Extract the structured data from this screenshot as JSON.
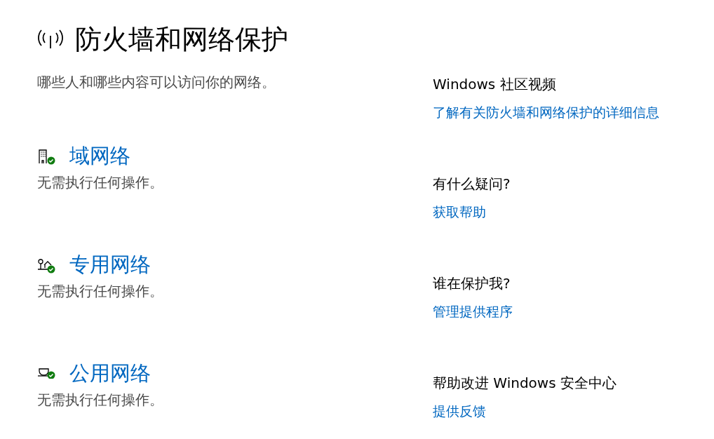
{
  "page": {
    "title": "防火墙和网络保护",
    "subtitle": "哪些人和哪些内容可以访问你的网络。"
  },
  "networks": [
    {
      "kind": "domain",
      "name": "域网络",
      "status": "无需执行任何操作。"
    },
    {
      "kind": "private",
      "name": "专用网络",
      "status": "无需执行任何操作。"
    },
    {
      "kind": "public",
      "name": "公用网络",
      "status": "无需执行任何操作。"
    }
  ],
  "side_sections": [
    {
      "heading": "Windows 社区视频",
      "link": "了解有关防火墙和网络保护的详细信息"
    },
    {
      "heading": "有什么疑问?",
      "link": "获取帮助"
    },
    {
      "heading": "谁在保护我?",
      "link": "管理提供程序"
    },
    {
      "heading": "帮助改进 Windows 安全中心",
      "link": "提供反馈"
    }
  ]
}
